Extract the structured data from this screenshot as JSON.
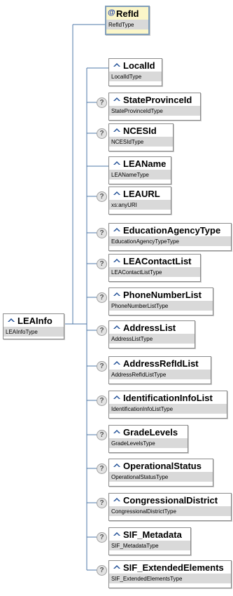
{
  "root": {
    "name": "LEAInfo",
    "type": "LEAInfoType",
    "icon": "element-icon"
  },
  "attribute": {
    "name": "RefId",
    "type": "RefIdType",
    "icon": "attribute-at-icon"
  },
  "elements": [
    {
      "name": "LocalId",
      "type": "LocalIdType",
      "optional": false
    },
    {
      "name": "StateProvinceId",
      "type": "StateProvinceIdType",
      "optional": true
    },
    {
      "name": "NCESId",
      "type": "NCESIdType",
      "optional": true
    },
    {
      "name": "LEAName",
      "type": "LEANameType",
      "optional": false
    },
    {
      "name": "LEAURL",
      "type": "xs:anyURI",
      "optional": true
    },
    {
      "name": "EducationAgencyType",
      "type": "EducationAgencyTypeType",
      "optional": true
    },
    {
      "name": "LEAContactList",
      "type": "LEAContactListType",
      "optional": true
    },
    {
      "name": "PhoneNumberList",
      "type": "PhoneNumberListType",
      "optional": true
    },
    {
      "name": "AddressList",
      "type": "AddressListType",
      "optional": true
    },
    {
      "name": "AddressRefIdList",
      "type": "AddressRefIdListType",
      "optional": true
    },
    {
      "name": "IdentificationInfoList",
      "type": "IdentificationInfoListType",
      "optional": true
    },
    {
      "name": "GradeLevels",
      "type": "GradeLevelsType",
      "optional": true
    },
    {
      "name": "OperationalStatus",
      "type": "OperationalStatusType",
      "optional": true
    },
    {
      "name": "CongressionalDistrict",
      "type": "CongressionalDistrictType",
      "optional": true
    },
    {
      "name": "SIF_Metadata",
      "type": "SIF_MetadataType",
      "optional": true
    },
    {
      "name": "SIF_ExtendedElements",
      "type": "SIF_ExtendedElementsType",
      "optional": true
    }
  ],
  "optional_marker": "?",
  "colors": {
    "connector": "#4f78a8",
    "type_band": "#d9d9d9",
    "attribute_fill": "#fbf6c9",
    "element_icon": "#1f4e96"
  }
}
